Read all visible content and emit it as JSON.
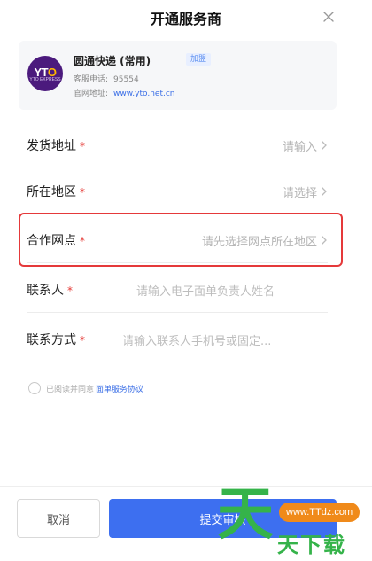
{
  "header": {
    "title": "开通服务商"
  },
  "provider": {
    "name": "圆通快递 (常用)",
    "tag": "加盟",
    "phone_label": "客服电话:",
    "phone": "95554",
    "site_label": "官网地址:",
    "site": "www.yto.net.cn",
    "logo_text_a": "YT",
    "logo_text_b": "O",
    "logo_sub": "YTO EXPRESS",
    "brand_color": "#4b1a7d"
  },
  "form": {
    "required_mark": "*",
    "rows": [
      {
        "label": "发货地址",
        "value": "请输入"
      },
      {
        "label": "所在地区",
        "value": "请选择"
      },
      {
        "label": "合作网点",
        "value": "请先选择网点所在地区"
      },
      {
        "label": "联系人",
        "placeholder": "请输入电子面单负责人姓名"
      },
      {
        "label": "联系方式",
        "placeholder": "请输入联系人手机号或固定..."
      }
    ]
  },
  "agreement": {
    "text": "已阅读并同意",
    "link": "面单服务协议"
  },
  "buttons": {
    "cancel": "取消",
    "submit": "提交审核"
  },
  "watermark": {
    "big": "天",
    "pill": "www.TTdz.com",
    "small": "天下载"
  },
  "colors": {
    "accent": "#3d6ff0",
    "required": "#e53935",
    "highlight": "#e5393a"
  }
}
